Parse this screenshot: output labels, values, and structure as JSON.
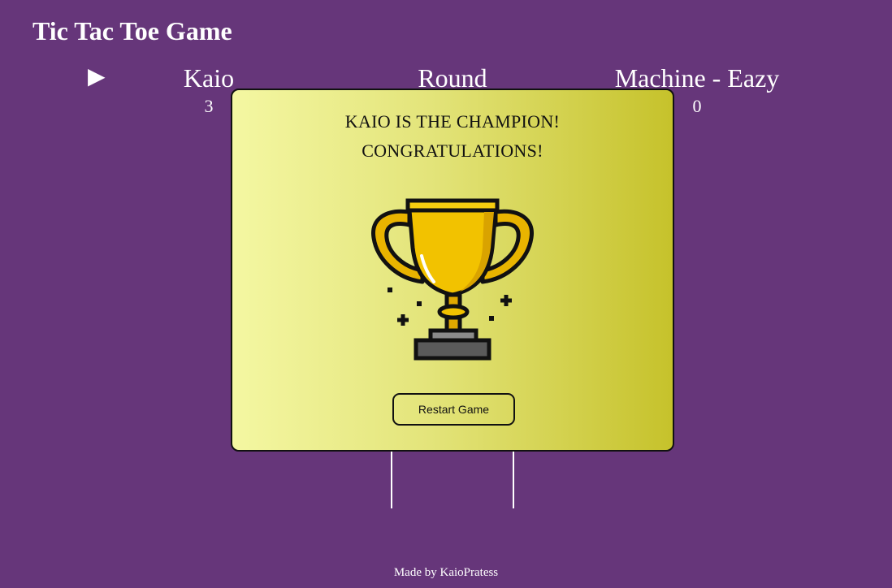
{
  "app": {
    "title": "Tic Tac Toe Game"
  },
  "scoreboard": {
    "turn_indicator": "▶",
    "player": {
      "name": "Kaio",
      "score": "3"
    },
    "round": {
      "label": "Round"
    },
    "machine": {
      "name": "Machine - Eazy",
      "score": "0"
    }
  },
  "modal": {
    "line1": "KAIO IS THE CHAMPION!",
    "line2": "CONGRATULATIONS!",
    "icon": "trophy-icon",
    "restart_label": "Restart Game"
  },
  "footer": {
    "text": "Made by KaioPratess"
  },
  "colors": {
    "background": "#66367a",
    "modal_gradient_start": "#f4f7a2",
    "modal_gradient_end": "#c6c22b",
    "trophy_gold": "#f2c200",
    "trophy_shade": "#d9a300"
  }
}
